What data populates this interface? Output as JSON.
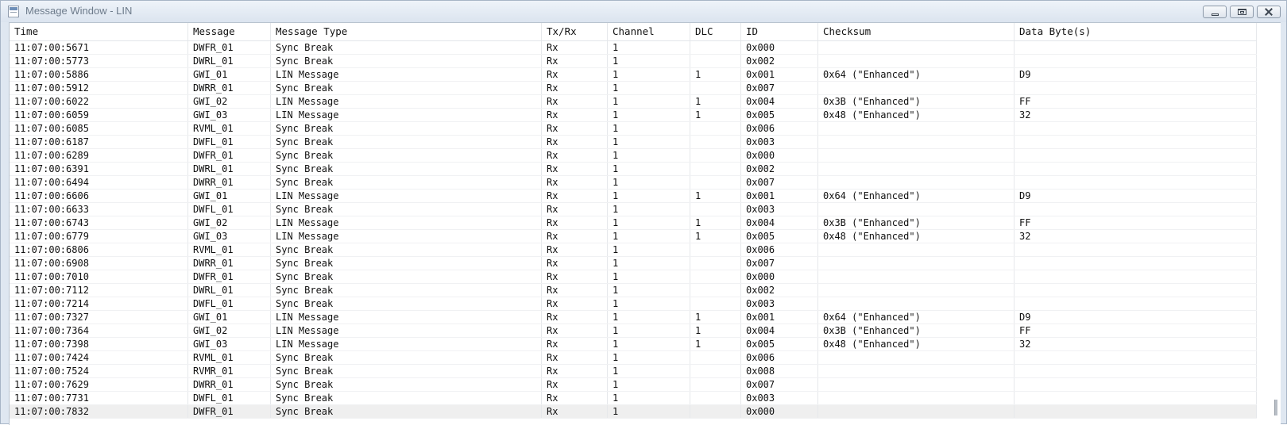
{
  "window": {
    "title": "Message Window - LIN"
  },
  "columns": {
    "time": "Time",
    "message": "Message",
    "message_type": "Message Type",
    "txrx": "Tx/Rx",
    "channel": "Channel",
    "dlc": "DLC",
    "id": "ID",
    "checksum": "Checksum",
    "data": "Data Byte(s)"
  },
  "rows": [
    {
      "time": "11:07:00:5671",
      "message": "DWFR_01",
      "type": "Sync Break",
      "txrx": "Rx",
      "channel": "1",
      "dlc": "",
      "id": "0x000",
      "checksum": "",
      "data": ""
    },
    {
      "time": "11:07:00:5773",
      "message": "DWRL_01",
      "type": "Sync Break",
      "txrx": "Rx",
      "channel": "1",
      "dlc": "",
      "id": "0x002",
      "checksum": "",
      "data": ""
    },
    {
      "time": "11:07:00:5886",
      "message": "GWI_01",
      "type": "LIN Message",
      "txrx": "Rx",
      "channel": "1",
      "dlc": "1",
      "id": "0x001",
      "checksum": "0x64 (\"Enhanced\")",
      "data": "D9"
    },
    {
      "time": "11:07:00:5912",
      "message": "DWRR_01",
      "type": "Sync Break",
      "txrx": "Rx",
      "channel": "1",
      "dlc": "",
      "id": "0x007",
      "checksum": "",
      "data": ""
    },
    {
      "time": "11:07:00:6022",
      "message": "GWI_02",
      "type": "LIN Message",
      "txrx": "Rx",
      "channel": "1",
      "dlc": "1",
      "id": "0x004",
      "checksum": "0x3B (\"Enhanced\")",
      "data": "FF"
    },
    {
      "time": "11:07:00:6059",
      "message": "GWI_03",
      "type": "LIN Message",
      "txrx": "Rx",
      "channel": "1",
      "dlc": "1",
      "id": "0x005",
      "checksum": "0x48 (\"Enhanced\")",
      "data": "32"
    },
    {
      "time": "11:07:00:6085",
      "message": "RVML_01",
      "type": "Sync Break",
      "txrx": "Rx",
      "channel": "1",
      "dlc": "",
      "id": "0x006",
      "checksum": "",
      "data": ""
    },
    {
      "time": "11:07:00:6187",
      "message": "DWFL_01",
      "type": "Sync Break",
      "txrx": "Rx",
      "channel": "1",
      "dlc": "",
      "id": "0x003",
      "checksum": "",
      "data": ""
    },
    {
      "time": "11:07:00:6289",
      "message": "DWFR_01",
      "type": "Sync Break",
      "txrx": "Rx",
      "channel": "1",
      "dlc": "",
      "id": "0x000",
      "checksum": "",
      "data": ""
    },
    {
      "time": "11:07:00:6391",
      "message": "DWRL_01",
      "type": "Sync Break",
      "txrx": "Rx",
      "channel": "1",
      "dlc": "",
      "id": "0x002",
      "checksum": "",
      "data": ""
    },
    {
      "time": "11:07:00:6494",
      "message": "DWRR_01",
      "type": "Sync Break",
      "txrx": "Rx",
      "channel": "1",
      "dlc": "",
      "id": "0x007",
      "checksum": "",
      "data": ""
    },
    {
      "time": "11:07:00:6606",
      "message": "GWI_01",
      "type": "LIN Message",
      "txrx": "Rx",
      "channel": "1",
      "dlc": "1",
      "id": "0x001",
      "checksum": "0x64 (\"Enhanced\")",
      "data": "D9"
    },
    {
      "time": "11:07:00:6633",
      "message": "DWFL_01",
      "type": "Sync Break",
      "txrx": "Rx",
      "channel": "1",
      "dlc": "",
      "id": "0x003",
      "checksum": "",
      "data": ""
    },
    {
      "time": "11:07:00:6743",
      "message": "GWI_02",
      "type": "LIN Message",
      "txrx": "Rx",
      "channel": "1",
      "dlc": "1",
      "id": "0x004",
      "checksum": "0x3B (\"Enhanced\")",
      "data": "FF"
    },
    {
      "time": "11:07:00:6779",
      "message": "GWI_03",
      "type": "LIN Message",
      "txrx": "Rx",
      "channel": "1",
      "dlc": "1",
      "id": "0x005",
      "checksum": "0x48 (\"Enhanced\")",
      "data": "32"
    },
    {
      "time": "11:07:00:6806",
      "message": "RVML_01",
      "type": "Sync Break",
      "txrx": "Rx",
      "channel": "1",
      "dlc": "",
      "id": "0x006",
      "checksum": "",
      "data": ""
    },
    {
      "time": "11:07:00:6908",
      "message": "DWRR_01",
      "type": "Sync Break",
      "txrx": "Rx",
      "channel": "1",
      "dlc": "",
      "id": "0x007",
      "checksum": "",
      "data": ""
    },
    {
      "time": "11:07:00:7010",
      "message": "DWFR_01",
      "type": "Sync Break",
      "txrx": "Rx",
      "channel": "1",
      "dlc": "",
      "id": "0x000",
      "checksum": "",
      "data": ""
    },
    {
      "time": "11:07:00:7112",
      "message": "DWRL_01",
      "type": "Sync Break",
      "txrx": "Rx",
      "channel": "1",
      "dlc": "",
      "id": "0x002",
      "checksum": "",
      "data": ""
    },
    {
      "time": "11:07:00:7214",
      "message": "DWFL_01",
      "type": "Sync Break",
      "txrx": "Rx",
      "channel": "1",
      "dlc": "",
      "id": "0x003",
      "checksum": "",
      "data": ""
    },
    {
      "time": "11:07:00:7327",
      "message": "GWI_01",
      "type": "LIN Message",
      "txrx": "Rx",
      "channel": "1",
      "dlc": "1",
      "id": "0x001",
      "checksum": "0x64 (\"Enhanced\")",
      "data": "D9"
    },
    {
      "time": "11:07:00:7364",
      "message": "GWI_02",
      "type": "LIN Message",
      "txrx": "Rx",
      "channel": "1",
      "dlc": "1",
      "id": "0x004",
      "checksum": "0x3B (\"Enhanced\")",
      "data": "FF"
    },
    {
      "time": "11:07:00:7398",
      "message": "GWI_03",
      "type": "LIN Message",
      "txrx": "Rx",
      "channel": "1",
      "dlc": "1",
      "id": "0x005",
      "checksum": "0x48 (\"Enhanced\")",
      "data": "32"
    },
    {
      "time": "11:07:00:7424",
      "message": "RVML_01",
      "type": "Sync Break",
      "txrx": "Rx",
      "channel": "1",
      "dlc": "",
      "id": "0x006",
      "checksum": "",
      "data": ""
    },
    {
      "time": "11:07:00:7524",
      "message": "RVMR_01",
      "type": "Sync Break",
      "txrx": "Rx",
      "channel": "1",
      "dlc": "",
      "id": "0x008",
      "checksum": "",
      "data": ""
    },
    {
      "time": "11:07:00:7629",
      "message": "DWRR_01",
      "type": "Sync Break",
      "txrx": "Rx",
      "channel": "1",
      "dlc": "",
      "id": "0x007",
      "checksum": "",
      "data": ""
    },
    {
      "time": "11:07:00:7731",
      "message": "DWFL_01",
      "type": "Sync Break",
      "txrx": "Rx",
      "channel": "1",
      "dlc": "",
      "id": "0x003",
      "checksum": "",
      "data": ""
    },
    {
      "time": "11:07:00:7832",
      "message": "DWFR_01",
      "type": "Sync Break",
      "txrx": "Rx",
      "channel": "1",
      "dlc": "",
      "id": "0x000",
      "checksum": "",
      "data": "",
      "selected": true
    }
  ]
}
